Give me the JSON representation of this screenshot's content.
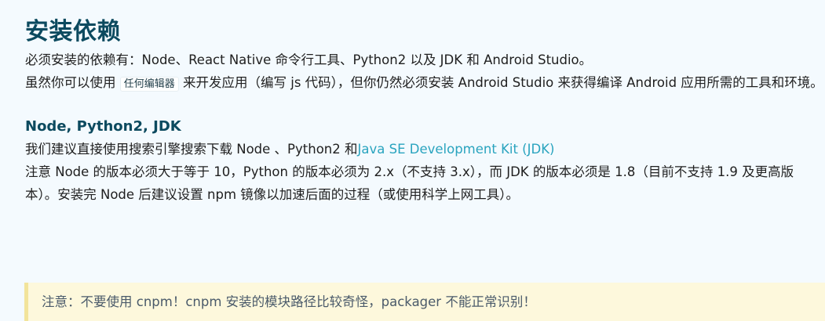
{
  "section": {
    "title": "安装依赖"
  },
  "intro": "必须安装的依赖有：Node、React Native 命令行工具、Python2 以及 JDK 和 Android Studio。",
  "editor_para": {
    "before": "虽然你可以使用",
    "code": "任何编辑器",
    "after": "来开发应用（编写 js 代码），但你仍然必须安装 Android Studio 来获得编译 Android 应用所需的工具和环境。"
  },
  "subsection": {
    "title": "Node, Python2, JDK"
  },
  "recommend_para": {
    "before": "我们建议直接使用搜索引擎搜索下载 Node 、Python2 和",
    "link": "Java SE Development Kit (JDK)"
  },
  "version_para": "注意 Node 的版本必须大于等于 10，Python 的版本必须为 2.x（不支持 3.x），而 JDK 的版本必须是 1.8（目前不支持 1.9 及更高版本）。安装完 Node 后建议设置 npm 镜像以加速后面的过程（或使用科学上网工具）。",
  "note": "注意：不要使用 cnpm！cnpm 安装的模块路径比较奇怪，packager 不能正常识别！",
  "colors": {
    "heading": "#0c4a5f",
    "link": "#2aa4bf",
    "note_bg": "#fdf8dc",
    "note_border": "#f2e49b"
  }
}
